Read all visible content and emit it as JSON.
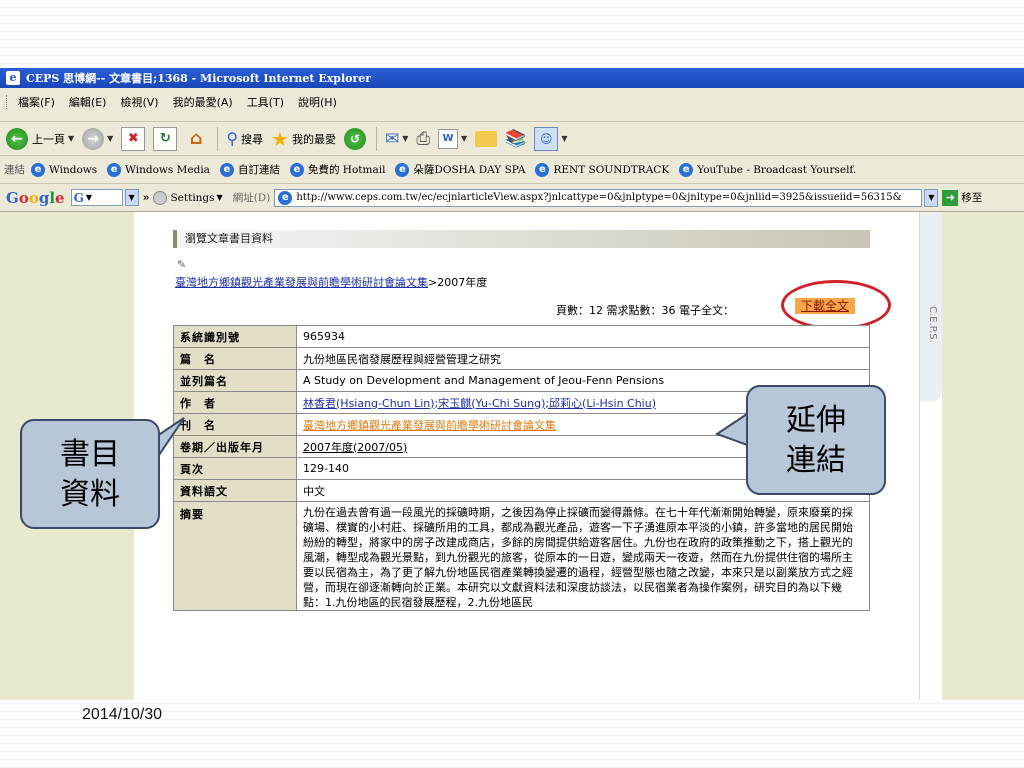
{
  "window": {
    "title": "CEPS 思博網-- 文章書目;1368 - Microsoft Internet Explorer"
  },
  "menu": [
    "檔案(F)",
    "編輯(E)",
    "檢視(V)",
    "我的最愛(A)",
    "工具(T)",
    "說明(H)"
  ],
  "toolbar": {
    "back_label": "上一頁",
    "search_label": "搜尋",
    "favorites_label": "我的最愛"
  },
  "links_bar": {
    "label": "連結",
    "items": [
      "Windows",
      "Windows Media",
      "自訂連結",
      "免費的 Hotmail",
      "朵薩DOSHA DAY SPA",
      "RENT SOUNDTRACK",
      "YouTube - Broadcast Yourself."
    ]
  },
  "google_bar": {
    "settings_label": "Settings",
    "address_label": "網址(D)",
    "url": "http://www.ceps.com.tw/ec/ecjnlarticleView.aspx?jnlcattype=0&jnlptype=0&jnltype=0&jnliid=3925&issueiid=56315&",
    "go_label": "移至"
  },
  "content": {
    "section_header": "瀏覽文章書目資料",
    "breadcrumb_link": "臺灣地方鄉鎮觀光產業發展與前瞻學術研討會論文集",
    "breadcrumb_rest": ">2007年度",
    "pages_text": "頁數：12   需求點數：36   電子全文：",
    "download_label": "下載全文",
    "side_label": "C.E.P.S.",
    "rows": [
      {
        "label": "系統識別號",
        "value": "965934"
      },
      {
        "label": "篇　名",
        "value": "九份地區民宿發展歷程與經營管理之研究"
      },
      {
        "label": "並列篇名",
        "value": "A Study on Development and Management of Jeou-Fenn Pensions"
      },
      {
        "label": "作　者",
        "value": "林香君(Hsiang-Chun Lin);宋玉麒(Yu-Chi Sung);邱莉心(Li-Hsin Chiu)"
      },
      {
        "label": "刊　名",
        "value": "臺灣地方鄉鎮觀光產業發展與前瞻學術研討會論文集"
      },
      {
        "label": "卷期／出版年月",
        "value": "2007年度(2007/05)"
      },
      {
        "label": "頁次",
        "value": "129-140"
      },
      {
        "label": "資料語文",
        "value": "中文"
      },
      {
        "label": "摘要",
        "value": "九份在過去曾有過一段風光的採礦時期，之後因為停止採礦而變得蕭條。在七十年代漸漸開始轉變，原來廢棄的採礦場、樸實的小村莊、採礦所用的工具，都成為觀光產品，遊客一下子湧進原本平淡的小鎮，許多當地的居民開始紛紛的轉型，將家中的房子改建成商店，多餘的房間提供給遊客居住。九份也在政府的政策推動之下，搭上觀光的風潮，轉型成為觀光景點，到九份觀光的旅客，從原本的一日遊，變成兩天一夜遊，然而在九份提供住宿的場所主要以民宿為主，為了更了解九份地區民宿產業轉換變遷的過程，經營型態也隨之改變，本來只是以副業放方式之經營，而現在卻逐漸轉向於正業。本研究以文獻資料法和深度訪談法，以民宿業者為操作案例，研究目的為以下幾點：1.九份地區的民宿發展歷程，2.九份地區民"
      }
    ]
  },
  "callouts": {
    "left_line1": "書目",
    "left_line2": "資料",
    "right_line1": "延伸",
    "right_line2": "連結"
  },
  "footer": {
    "date": "2014/10/30"
  },
  "colors": {
    "title_bar": "#1c52c9",
    "label_cell": "#e2dfc6",
    "callout_fill": "#b8c7d8",
    "highlight_ring": "#d0202a",
    "download_btn": "#f7a64a"
  }
}
